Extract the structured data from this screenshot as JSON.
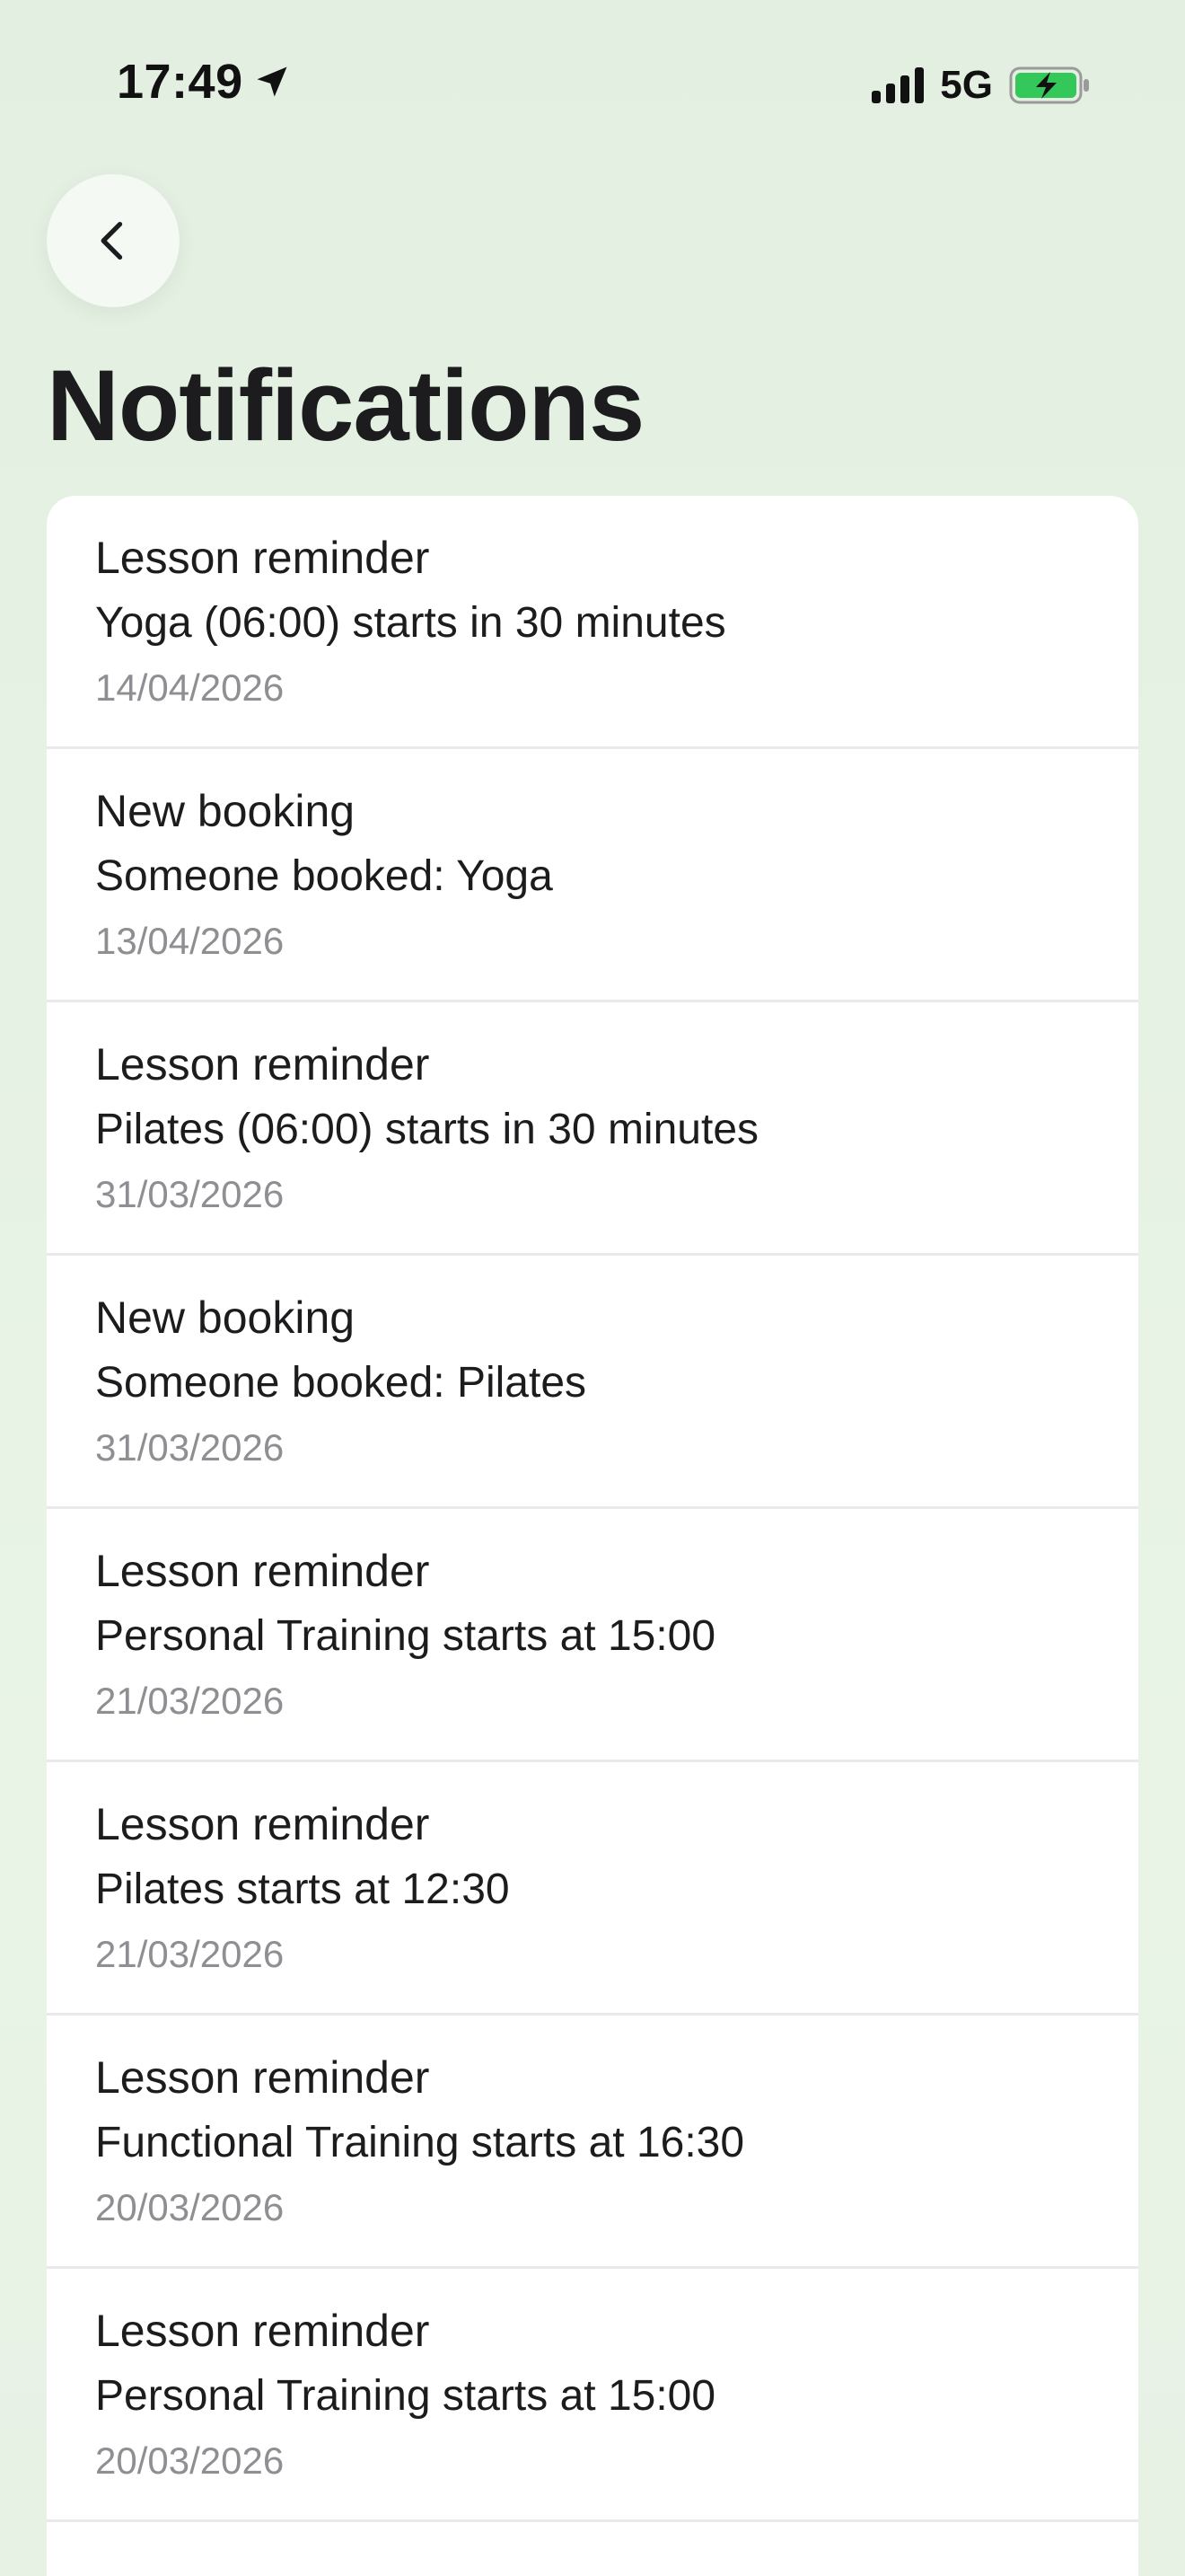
{
  "status_bar": {
    "time": "17:49",
    "network": "5G",
    "location_icon": "location-arrow-icon",
    "signal_icon": "cellular-signal-icon",
    "battery_icon": "battery-charging-icon",
    "battery_color": "#34c759"
  },
  "header": {
    "back_icon": "chevron-left-icon",
    "title": "Notifications"
  },
  "notifications": [
    {
      "title": "Lesson reminder",
      "message": "Yoga (06:00) starts in 30 minutes",
      "date": "14/04/2026"
    },
    {
      "title": "New booking",
      "message": "Someone booked: Yoga",
      "date": "13/04/2026"
    },
    {
      "title": "Lesson reminder",
      "message": "Pilates (06:00) starts in 30 minutes",
      "date": "31/03/2026"
    },
    {
      "title": "New booking",
      "message": "Someone booked: Pilates",
      "date": "31/03/2026"
    },
    {
      "title": "Lesson reminder",
      "message": "Personal Training starts at 15:00",
      "date": "21/03/2026"
    },
    {
      "title": "Lesson reminder",
      "message": "Pilates starts at 12:30",
      "date": "21/03/2026"
    },
    {
      "title": "Lesson reminder",
      "message": "Functional Training starts at 16:30",
      "date": "20/03/2026"
    },
    {
      "title": "Lesson reminder",
      "message": "Personal Training starts at 15:00",
      "date": "20/03/2026"
    }
  ]
}
